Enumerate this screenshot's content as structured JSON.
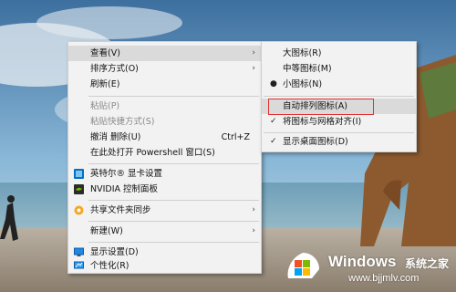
{
  "main_menu": {
    "items": [
      {
        "label": "查看(V)",
        "arrow": "›"
      },
      {
        "label": "排序方式(O)",
        "arrow": "›"
      },
      {
        "label": "刷新(E)"
      },
      {
        "label": "粘贴(P)"
      },
      {
        "label": "粘贴快捷方式(S)"
      },
      {
        "label": "撤消 删除(U)",
        "shortcut": "Ctrl+Z"
      },
      {
        "label": "在此处打开 Powershell 窗口(S)"
      },
      {
        "label": "英特尔® 显卡设置"
      },
      {
        "label": "NVIDIA 控制面板"
      },
      {
        "label": "共享文件夹同步",
        "arrow": "›"
      },
      {
        "label": "新建(W)",
        "arrow": "›"
      },
      {
        "label": "显示设置(D)"
      },
      {
        "label": "个性化(R)"
      }
    ]
  },
  "sub_menu": {
    "items": [
      {
        "label": "大图标(R)"
      },
      {
        "label": "中等图标(M)"
      },
      {
        "label": "小图标(N)",
        "mark": "●"
      },
      {
        "label": "自动排列图标(A)"
      },
      {
        "label": "将图标与网格对齐(I)",
        "mark": "✓"
      },
      {
        "label": "显示桌面图标(D)",
        "mark": "✓"
      }
    ]
  },
  "icons": {
    "intel": "intel-graphics-icon",
    "nvidia": "nvidia-icon",
    "share": "share-folder-icon",
    "display": "display-settings-icon",
    "personalize": "personalize-icon"
  },
  "watermark": {
    "title": "Windows",
    "subtitle": "系统之家",
    "url": "www.bjjmlv.com"
  },
  "colors": {
    "menu_bg": "#f2f2f2",
    "hover_bg": "#dadada",
    "highlight_box": "#e03030",
    "windows_logo": "#1e88e5"
  }
}
